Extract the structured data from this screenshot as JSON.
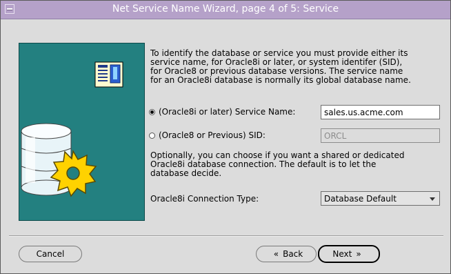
{
  "window": {
    "title": "Net Service Name Wizard, page 4 of 5: Service"
  },
  "description": "To identify the database or service you must provide either its\nservice name, for Oracle8i or later, or system identifer (SID),\nfor Oracle8 or previous database versions. The service name\nfor an Oracle8i database is normally its global database name.",
  "service_option": {
    "label": "(Oracle8i or later)  Service Name:",
    "value": "sales.us.acme.com",
    "selected": true
  },
  "sid_option": {
    "label": "(Oracle8 or Previous) SID:",
    "value": "ORCL",
    "selected": false
  },
  "connection_description": "Optionally, you can choose if you want a shared or dedicated\nOracle8i database connection. The default is to let the\ndatabase decide.",
  "connection_type": {
    "label": "Oracle8i Connection Type:",
    "value": "Database Default"
  },
  "buttons": {
    "cancel": "Cancel",
    "back": "Back",
    "next": "Next"
  },
  "colors": {
    "titlebar": "#b5a1c9",
    "panel": "#238080"
  },
  "icons": [
    "system-menu-icon",
    "document-icon",
    "database-icon",
    "gear-icon",
    "back-arrow-icon",
    "next-arrow-icon",
    "dropdown-arrow-icon"
  ]
}
